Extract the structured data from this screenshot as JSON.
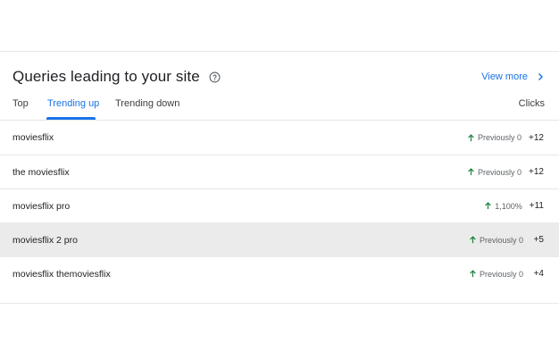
{
  "header": {
    "title": "Queries leading to your site",
    "view_more_label": "View more"
  },
  "tabs": [
    {
      "label": "Top",
      "active": false
    },
    {
      "label": "Trending up",
      "active": true
    },
    {
      "label": "Trending down",
      "active": false
    }
  ],
  "columns": {
    "clicks_label": "Clicks"
  },
  "rows": [
    {
      "query": "moviesflix",
      "trend": "Previously 0",
      "clicks": "+12"
    },
    {
      "query": "the moviesflix",
      "trend": "Previously 0",
      "clicks": "+12"
    },
    {
      "query": "moviesflix pro",
      "trend": "1,100%",
      "clicks": "+11"
    },
    {
      "query": "moviesflix 2 pro",
      "trend": "Previously 0",
      "clicks": "+5"
    },
    {
      "query": "moviesflix themoviesflix",
      "trend": "Previously 0",
      "clicks": "+4"
    }
  ],
  "colors": {
    "accent": "#1a73e8",
    "trend_up": "#188038",
    "hover_row": "#ebebeb"
  },
  "icons": {
    "help": "help-circle-icon",
    "view_more": "chevron-right-icon",
    "trend": "arrow-up-icon"
  }
}
